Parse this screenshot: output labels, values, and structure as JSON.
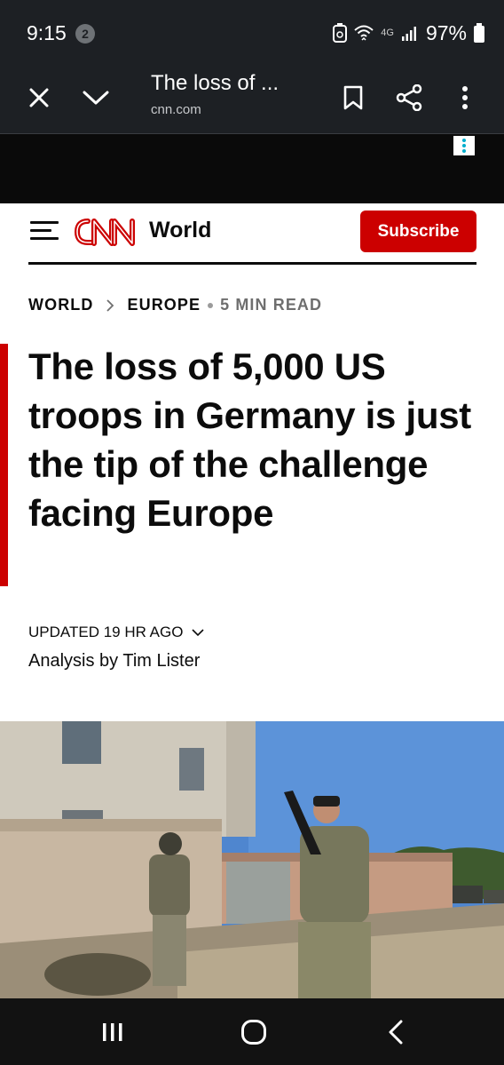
{
  "status_bar": {
    "time": "9:15",
    "notification_count": "2",
    "network": "4G",
    "battery": "97%"
  },
  "browser": {
    "page_title": "The loss of ...",
    "url": "cnn.com",
    "icons": [
      "close-icon",
      "chevron-down-icon",
      "bookmark-icon",
      "share-icon",
      "more-vert-icon"
    ]
  },
  "site": {
    "logo": "CNN",
    "section": "World",
    "subscribe_label": "Subscribe",
    "brand_color": "#cc0000"
  },
  "breadcrumb": {
    "items": [
      "WORLD",
      "EUROPE"
    ],
    "read_time": "5 MIN READ"
  },
  "article": {
    "headline": "The loss of 5,000 US troops in Germany is just the tip of the challenge facing Europe",
    "updated": "UPDATED 19 HR AGO",
    "byline": "Analysis by Tim Lister"
  },
  "nav_bar": {
    "icons": [
      "recent-apps-icon",
      "home-icon",
      "back-icon"
    ]
  }
}
